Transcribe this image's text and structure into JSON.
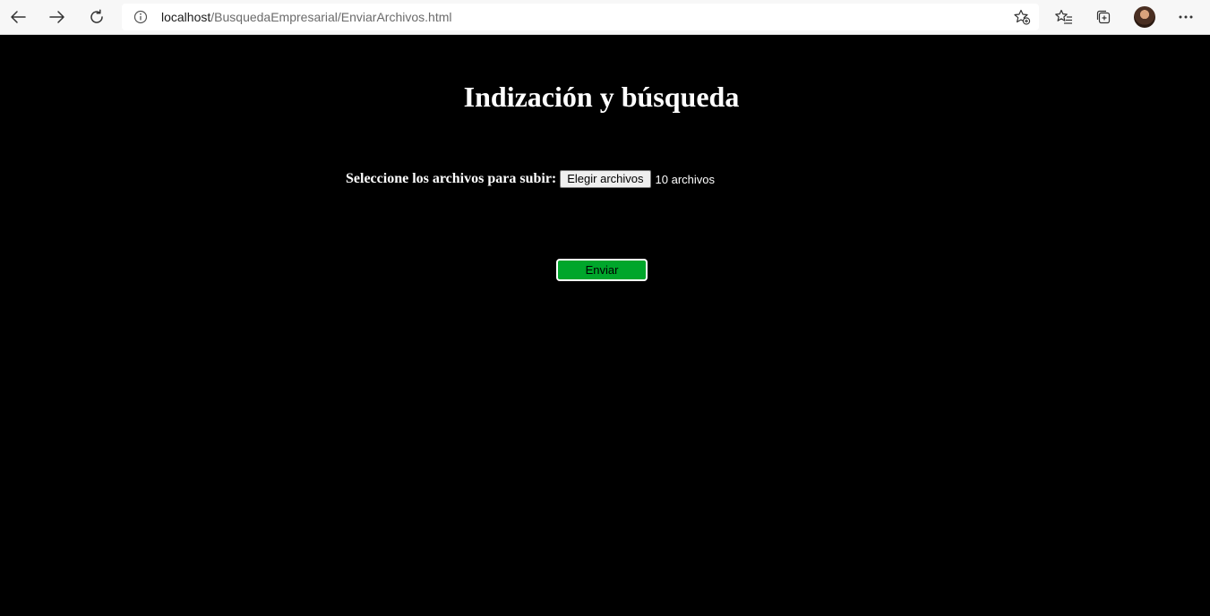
{
  "browser": {
    "url_host": "localhost",
    "url_path": "/BusquedaEmpresarial/EnviarArchivos.html",
    "icons": {
      "back": "back-arrow-icon",
      "forward": "forward-arrow-icon",
      "refresh": "refresh-icon",
      "info": "info-icon",
      "add_favorite": "star-add-icon",
      "favorites": "favorites-icon",
      "collections": "collections-icon",
      "profile": "avatar",
      "menu": "more-icon"
    }
  },
  "page": {
    "title": "Indización y búsqueda",
    "upload_label": "Seleccione los archivos para subir:",
    "file_button_label": "Elegir archivos",
    "file_status": "10 archivos",
    "submit_label": "Enviar"
  },
  "colors": {
    "page_background": "#000000",
    "text": "#ffffff",
    "submit_background": "#00a62b"
  }
}
